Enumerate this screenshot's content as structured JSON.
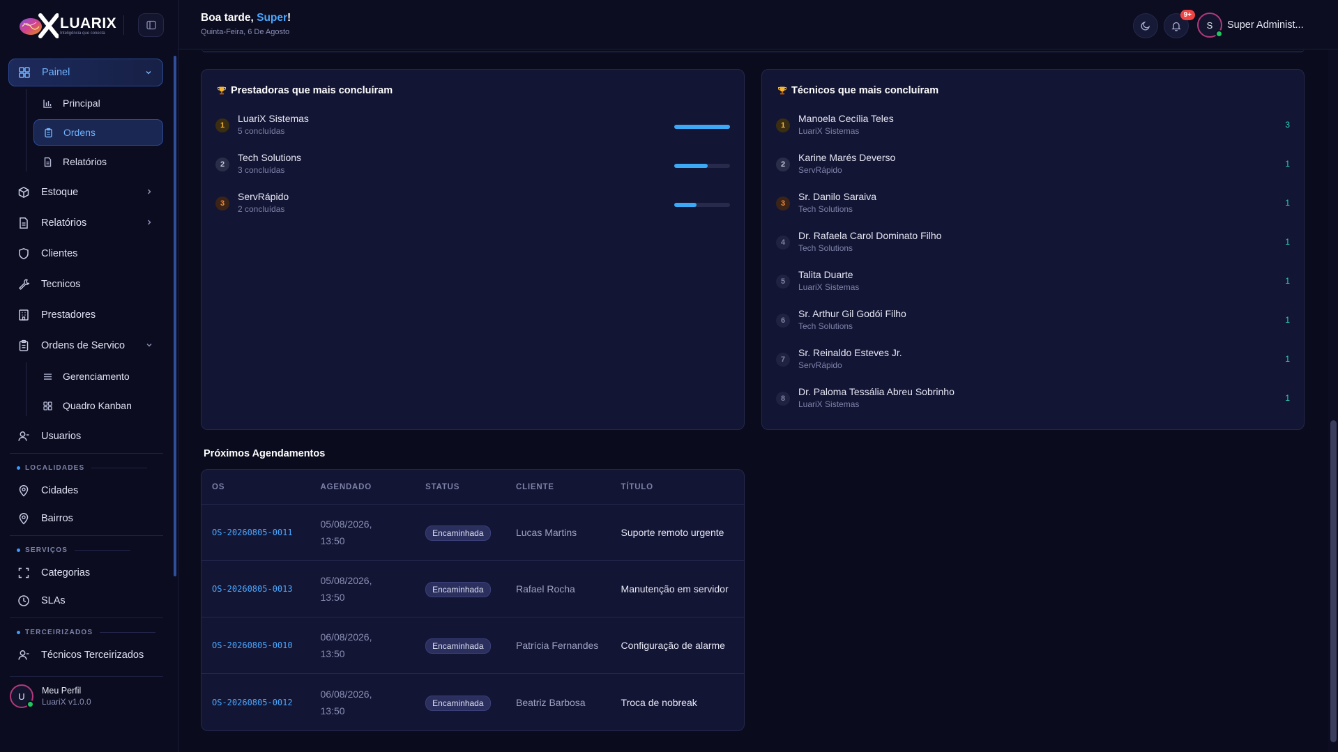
{
  "app": {
    "logo_name": "LUARIX",
    "logo_tagline": "Inteligência que conecta",
    "accent": "#4aa8ff",
    "success": "#22c55e"
  },
  "header": {
    "greeting_prefix": "Boa tarde, ",
    "greeting_name": "Super",
    "greeting_suffix": "!",
    "date": "Quinta-Feira, 6 De Agosto",
    "notifications_badge": "9+",
    "user_initial": "S",
    "user_name": "Super Administ..."
  },
  "sidebar": {
    "painel": "Painel",
    "painel_children": [
      "Principal",
      "Ordens",
      "Relatórios"
    ],
    "estoque": "Estoque",
    "relatorios": "Relatórios",
    "clientes": "Clientes",
    "tecnicos": "Tecnicos",
    "prestadores": "Prestadores",
    "ordens_servico": "Ordens de Servico",
    "ordens_children": [
      "Gerenciamento",
      "Quadro Kanban"
    ],
    "usuarios": "Usuarios",
    "section_localidades": "LOCALIDADES",
    "cidades": "Cidades",
    "bairros": "Bairros",
    "section_servicos": "SERVIÇOS",
    "categorias": "Categorias",
    "slas": "SLAs",
    "section_terceirizados": "TERCEIRIZADOS",
    "tecnicos_terceirizados": "Técnicos Terceirizados",
    "profile_initial": "U",
    "profile_name": "Meu Perfil",
    "profile_version": "LuariX v1.0.0"
  },
  "prestadoras": {
    "title": "Prestadoras que mais concluíram",
    "items": [
      {
        "rank": "1",
        "name": "LuariX Sistemas",
        "sub": "5 concluídas",
        "fraction": 1.0
      },
      {
        "rank": "2",
        "name": "Tech Solutions",
        "sub": "3 concluídas",
        "fraction": 0.6
      },
      {
        "rank": "3",
        "name": "ServRápido",
        "sub": "2 concluídas",
        "fraction": 0.4
      }
    ]
  },
  "tecnicos": {
    "title": "Técnicos que mais concluíram",
    "items": [
      {
        "rank": "1",
        "name": "Manoela Cecília Teles",
        "sub": "LuariX Sistemas",
        "count": "3"
      },
      {
        "rank": "2",
        "name": "Karine Marés Deverso",
        "sub": "ServRápido",
        "count": "1"
      },
      {
        "rank": "3",
        "name": "Sr. Danilo Saraiva",
        "sub": "Tech Solutions",
        "count": "1"
      },
      {
        "rank": "4",
        "name": "Dr. Rafaela Carol Dominato Filho",
        "sub": "Tech Solutions",
        "count": "1"
      },
      {
        "rank": "5",
        "name": "Talita Duarte",
        "sub": "LuariX Sistemas",
        "count": "1"
      },
      {
        "rank": "6",
        "name": "Sr. Arthur Gil Godói Filho",
        "sub": "Tech Solutions",
        "count": "1"
      },
      {
        "rank": "7",
        "name": "Sr. Reinaldo Esteves Jr.",
        "sub": "ServRápido",
        "count": "1"
      },
      {
        "rank": "8",
        "name": "Dr. Paloma Tessália Abreu Sobrinho",
        "sub": "LuariX Sistemas",
        "count": "1"
      }
    ]
  },
  "agendamentos": {
    "title": "Próximos Agendamentos",
    "columns": [
      "OS",
      "AGENDADO",
      "STATUS",
      "CLIENTE",
      "TÍTULO"
    ],
    "rows": [
      {
        "os": "OS-20260805-0011",
        "date": "05/08/2026,",
        "time": "13:50",
        "status": "Encaminhada",
        "client": "Lucas Martins",
        "title": "Suporte remoto urgente"
      },
      {
        "os": "OS-20260805-0013",
        "date": "05/08/2026,",
        "time": "13:50",
        "status": "Encaminhada",
        "client": "Rafael Rocha",
        "title": "Manutenção em servidor"
      },
      {
        "os": "OS-20260805-0010",
        "date": "06/08/2026,",
        "time": "13:50",
        "status": "Encaminhada",
        "client": "Patrícia Fernandes",
        "title": "Configuração de alarme"
      },
      {
        "os": "OS-20260805-0012",
        "date": "06/08/2026,",
        "time": "13:50",
        "status": "Encaminhada",
        "client": "Beatriz Barbosa",
        "title": "Troca de nobreak"
      }
    ]
  }
}
